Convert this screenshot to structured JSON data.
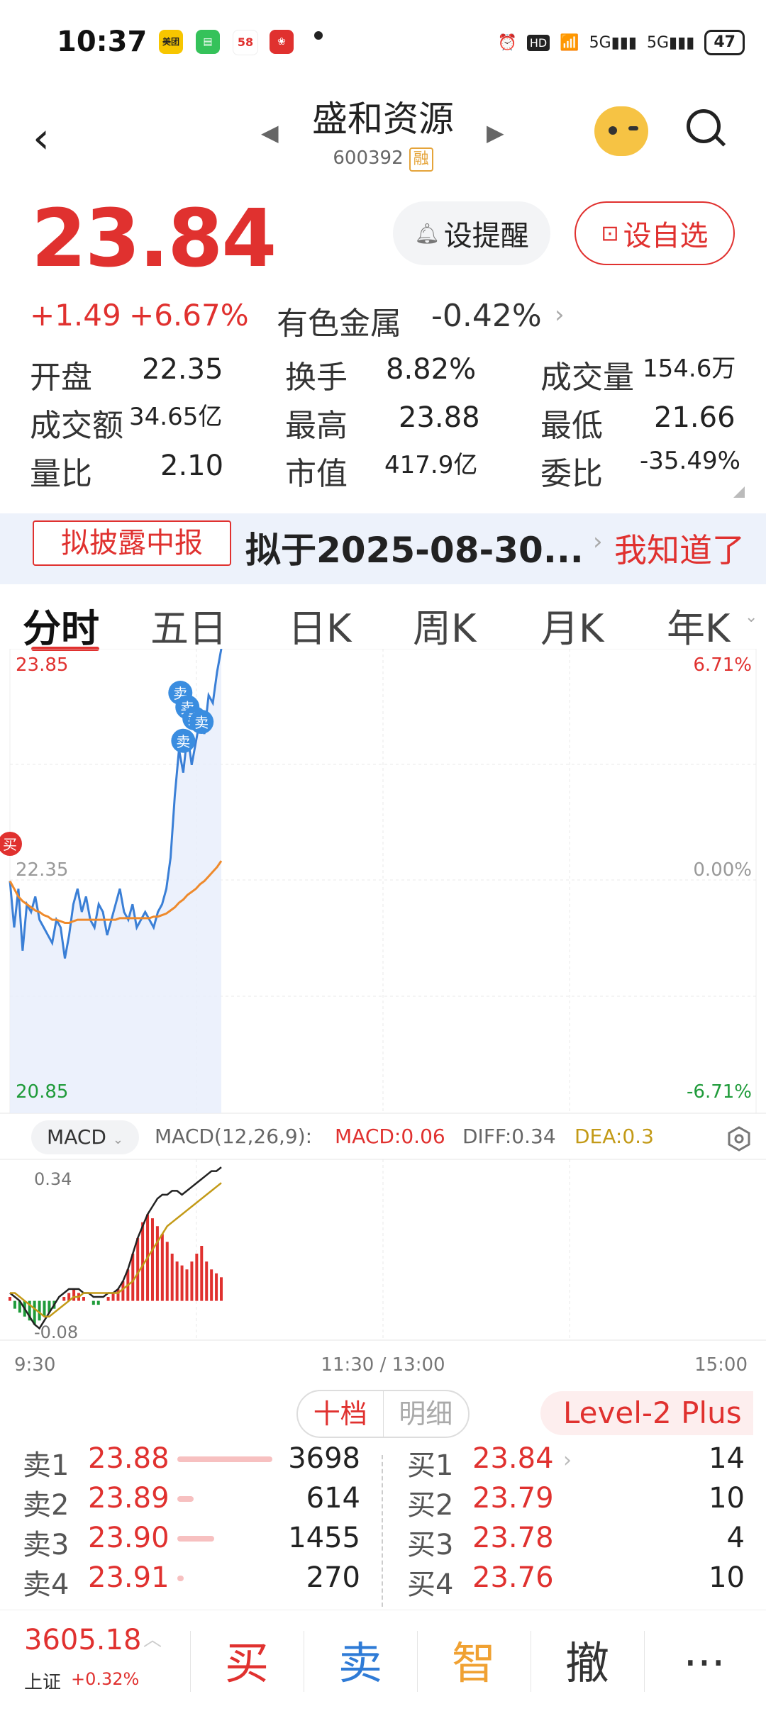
{
  "status_bar": {
    "time": "10:37",
    "apps": [
      {
        "name": "美团",
        "color": "#f7c600"
      },
      {
        "name": "",
        "color": "#35c25a"
      },
      {
        "name": "58",
        "color": "#ffffff"
      },
      {
        "name": "",
        "color": "#e0312f"
      }
    ],
    "network": "5G",
    "battery": "47"
  },
  "header": {
    "title": "盛和资源",
    "code": "600392",
    "rong_tag": "融"
  },
  "quote": {
    "price": "23.84",
    "change": "+1.49",
    "change_pct": "+6.67%",
    "remind_btn": "设提醒",
    "watch_btn": "设自选",
    "sector_name": "有色金属",
    "sector_change": "-0.42%"
  },
  "stats": [
    {
      "label": "开盘",
      "value": "22.35",
      "color": "#222"
    },
    {
      "label": "换手",
      "value": "8.82%",
      "color": "#222"
    },
    {
      "label": "成交量",
      "value": "154.6万",
      "color": "#222"
    },
    {
      "label": "成交额",
      "value": "34.65亿",
      "color": "#222"
    },
    {
      "label": "最高",
      "value": "23.88",
      "color": "#e0312f"
    },
    {
      "label": "最低",
      "value": "21.66",
      "color": "#1f9b3a"
    },
    {
      "label": "量比",
      "value": "2.10",
      "color": "#222"
    },
    {
      "label": "市值",
      "value": "417.9亿",
      "color": "#222"
    },
    {
      "label": "委比",
      "value": "-35.49%",
      "color": "#1f9b3a"
    }
  ],
  "notice": {
    "tag": "拟披露中报",
    "text": "拟于2025-08-30...",
    "action": "我知道了"
  },
  "tabs": [
    "分时",
    "五日",
    "日K",
    "周K",
    "月K",
    "年K"
  ],
  "chart_data": [
    {
      "type": "line",
      "title": "分时",
      "y_left_labels": [
        "23.85",
        "22.35",
        "20.85"
      ],
      "y_right_labels": [
        "6.71%",
        "0.00%",
        "-6.71%"
      ],
      "x_labels": [
        "9:30",
        "11:30 / 13:00",
        "15:00"
      ],
      "ylim": [
        20.85,
        23.85
      ],
      "series": [
        {
          "name": "price",
          "color": "#3a7fd6",
          "values": [
            22.35,
            22.05,
            22.3,
            21.9,
            22.2,
            22.15,
            22.25,
            22.1,
            22.05,
            22.0,
            21.95,
            22.1,
            22.05,
            21.85,
            22.0,
            22.2,
            22.3,
            22.15,
            22.25,
            22.1,
            22.05,
            22.2,
            22.15,
            22.0,
            22.1,
            22.2,
            22.3,
            22.15,
            22.1,
            22.2,
            22.05,
            22.1,
            22.15,
            22.1,
            22.05,
            22.15,
            22.2,
            22.3,
            22.5,
            22.9,
            23.2,
            23.05,
            23.3,
            23.1,
            23.25,
            23.4,
            23.3,
            23.55,
            23.5,
            23.7,
            23.85
          ]
        },
        {
          "name": "avg",
          "color": "#ee8a2c",
          "values": [
            22.35,
            22.3,
            22.25,
            22.22,
            22.2,
            22.18,
            22.16,
            22.15,
            22.13,
            22.12,
            22.1,
            22.1,
            22.09,
            22.08,
            22.08,
            22.09,
            22.1,
            22.1,
            22.1,
            22.1,
            22.1,
            22.1,
            22.1,
            22.1,
            22.1,
            22.1,
            22.11,
            22.11,
            22.11,
            22.11,
            22.11,
            22.11,
            22.11,
            22.11,
            22.12,
            22.12,
            22.13,
            22.14,
            22.16,
            22.18,
            22.21,
            22.23,
            22.26,
            22.28,
            22.3,
            22.33,
            22.35,
            22.38,
            22.41,
            22.44,
            22.48
          ]
        }
      ],
      "annotations": [
        "卖",
        "卖",
        "卖",
        "卖",
        "卖",
        "买"
      ]
    },
    {
      "type": "bar",
      "title": "MACD",
      "y_labels": [
        "0.34",
        "-0.08"
      ],
      "ylim": [
        -0.1,
        0.36
      ],
      "histogram": [
        0.01,
        -0.02,
        -0.03,
        -0.04,
        -0.05,
        -0.06,
        -0.05,
        -0.04,
        -0.03,
        -0.02,
        0.0,
        0.01,
        0.02,
        0.03,
        0.02,
        0.01,
        0.0,
        -0.01,
        -0.01,
        0.0,
        0.01,
        0.02,
        0.03,
        0.05,
        0.08,
        0.12,
        0.16,
        0.2,
        0.22,
        0.21,
        0.19,
        0.17,
        0.15,
        0.12,
        0.1,
        0.09,
        0.08,
        0.1,
        0.12,
        0.14,
        0.1,
        0.08,
        0.07,
        0.06
      ],
      "diff": [
        0.02,
        0.01,
        0.0,
        -0.02,
        -0.04,
        -0.06,
        -0.07,
        -0.05,
        -0.03,
        -0.01,
        0.01,
        0.02,
        0.03,
        0.03,
        0.03,
        0.02,
        0.02,
        0.01,
        0.01,
        0.01,
        0.02,
        0.02,
        0.03,
        0.05,
        0.08,
        0.12,
        0.16,
        0.19,
        0.22,
        0.24,
        0.26,
        0.27,
        0.27,
        0.28,
        0.28,
        0.27,
        0.28,
        0.29,
        0.3,
        0.31,
        0.32,
        0.33,
        0.33,
        0.34
      ],
      "dea": [
        0.02,
        0.02,
        0.01,
        0.0,
        -0.01,
        -0.02,
        -0.03,
        -0.04,
        -0.04,
        -0.03,
        -0.02,
        -0.01,
        0.0,
        0.01,
        0.01,
        0.02,
        0.02,
        0.02,
        0.02,
        0.02,
        0.02,
        0.02,
        0.02,
        0.03,
        0.04,
        0.05,
        0.07,
        0.09,
        0.11,
        0.13,
        0.15,
        0.17,
        0.19,
        0.2,
        0.21,
        0.22,
        0.23,
        0.24,
        0.25,
        0.26,
        0.27,
        0.28,
        0.29,
        0.3
      ]
    }
  ],
  "macd_bar": {
    "selector": "MACD",
    "params": "MACD(12,26,9):",
    "macd": "MACD:0.06",
    "diff": "DIFF:0.34",
    "dea": "DEA:0.3"
  },
  "order_book": {
    "toggle": [
      "十档",
      "明细"
    ],
    "level2": "Level-2 Plus",
    "asks": [
      {
        "label": "卖1",
        "price": "23.88",
        "volume": "3698",
        "ratio": 1.0
      },
      {
        "label": "卖2",
        "price": "23.89",
        "volume": "614",
        "ratio": 0.17
      },
      {
        "label": "卖3",
        "price": "23.90",
        "volume": "1455",
        "ratio": 0.39
      },
      {
        "label": "卖4",
        "price": "23.91",
        "volume": "270",
        "ratio": 0.07
      }
    ],
    "bids": [
      {
        "label": "买1",
        "price": "23.84",
        "volume": "14"
      },
      {
        "label": "买2",
        "price": "23.79",
        "volume": "10"
      },
      {
        "label": "买3",
        "price": "23.78",
        "volume": "4"
      },
      {
        "label": "买4",
        "price": "23.76",
        "volume": "10"
      }
    ]
  },
  "bottom_bar": {
    "index_value": "3605.18",
    "index_name": "上证",
    "index_change": "+0.32%",
    "buttons": [
      {
        "label": "买",
        "color": "#e0312f"
      },
      {
        "label": "卖",
        "color": "#2f7bd6"
      },
      {
        "label": "智",
        "color": "#f0a132"
      },
      {
        "label": "撤",
        "color": "#333333"
      },
      {
        "label": "···",
        "color": "#333333"
      }
    ]
  }
}
